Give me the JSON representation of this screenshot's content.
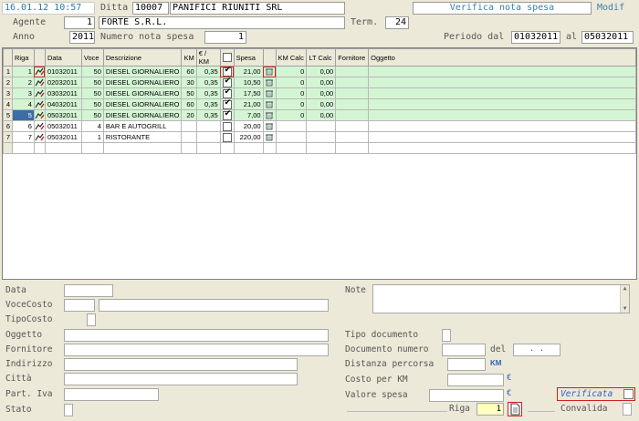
{
  "header": {
    "datetime": "16.01.12 10:57",
    "ditta_label": "Ditta",
    "ditta_code": "10007",
    "ditta_name": "PANIFICI RIUNITI SRL",
    "title": "Verifica nota spesa",
    "mode": "Modif",
    "agente_label": "Agente",
    "agente_num": "1",
    "agente_name": "FORTE S.R.L.",
    "term_label": "Term.",
    "term_value": "24",
    "anno_label": "Anno",
    "anno_value": "2011",
    "numero_label": "Numero nota spesa",
    "numero_value": "1",
    "periodo_label": "Periodo dal",
    "periodo_dal": "01032011",
    "al_label": "al",
    "periodo_al": "05032011"
  },
  "grid": {
    "columns": [
      "Riga",
      "Data",
      "Voce",
      "Descrizione",
      "KM",
      "€ / KM",
      "",
      "Spesa",
      "",
      "KM Calc",
      "LT Calc",
      "Fornitore",
      "Oggetto"
    ],
    "rows": [
      {
        "idx": "1",
        "riga": "1",
        "data": "01032011",
        "voce": "50",
        "descr": "DIESEL GIORNALIERO",
        "km": "60",
        "eurkm": "0,35",
        "checked": true,
        "spesa": "21,00",
        "kmcalc": "0",
        "ltcalc": "0,00",
        "green": true
      },
      {
        "idx": "2",
        "riga": "2",
        "data": "02032011",
        "voce": "50",
        "descr": "DIESEL GIORNALIERO",
        "km": "30",
        "eurkm": "0,35",
        "checked": true,
        "spesa": "10,50",
        "kmcalc": "0",
        "ltcalc": "0,00",
        "green": true
      },
      {
        "idx": "3",
        "riga": "3",
        "data": "03032011",
        "voce": "50",
        "descr": "DIESEL GIORNALIERO",
        "km": "50",
        "eurkm": "0,35",
        "checked": true,
        "spesa": "17,50",
        "kmcalc": "0",
        "ltcalc": "0,00",
        "green": true
      },
      {
        "idx": "4",
        "riga": "4",
        "data": "04032011",
        "voce": "50",
        "descr": "DIESEL GIORNALIERO",
        "km": "60",
        "eurkm": "0,35",
        "checked": true,
        "spesa": "21,00",
        "kmcalc": "0",
        "ltcalc": "0,00",
        "green": true
      },
      {
        "idx": "5",
        "riga": "5",
        "data": "05032011",
        "voce": "50",
        "descr": "DIESEL GIORNALIERO",
        "km": "20",
        "eurkm": "0,35",
        "checked": true,
        "spesa": "7,00",
        "kmcalc": "0",
        "ltcalc": "0,00",
        "green": true,
        "selected": true
      },
      {
        "idx": "6",
        "riga": "6",
        "data": "05032011",
        "voce": "4",
        "descr": "BAR E AUTOGRILL",
        "km": "",
        "eurkm": "",
        "checked": false,
        "spesa": "20,00",
        "kmcalc": "",
        "ltcalc": "",
        "green": false
      },
      {
        "idx": "7",
        "riga": "7",
        "data": "05032011",
        "voce": "1",
        "descr": "RISTORANTE",
        "km": "",
        "eurkm": "",
        "checked": false,
        "spesa": "220,00",
        "kmcalc": "",
        "ltcalc": "",
        "green": false
      }
    ]
  },
  "form": {
    "data_label": "Data",
    "vocecosto_label": "VoceCosto",
    "tipocosto_label": "TipoCosto",
    "oggetto_label": "Oggetto",
    "fornitore_label": "Fornitore",
    "indirizzo_label": "Indirizzo",
    "citta_label": "Città",
    "partiva_label": "Part. Iva",
    "stato_label": "Stato",
    "note_label": "Note",
    "tipodoc_label": "Tipo documento",
    "docnum_label": "Documento numero",
    "del_label": "del",
    "del_value": ". .",
    "distanza_label": "Distanza percorsa",
    "km_unit": "KM",
    "costokm_label": "Costo per KM",
    "euro1": "€",
    "valore_label": "Valore spesa",
    "euro2": "€",
    "verificata_label": "Verificata",
    "riga_label": "Riga",
    "riga_value": "1",
    "convalida_label": "Convalida"
  }
}
